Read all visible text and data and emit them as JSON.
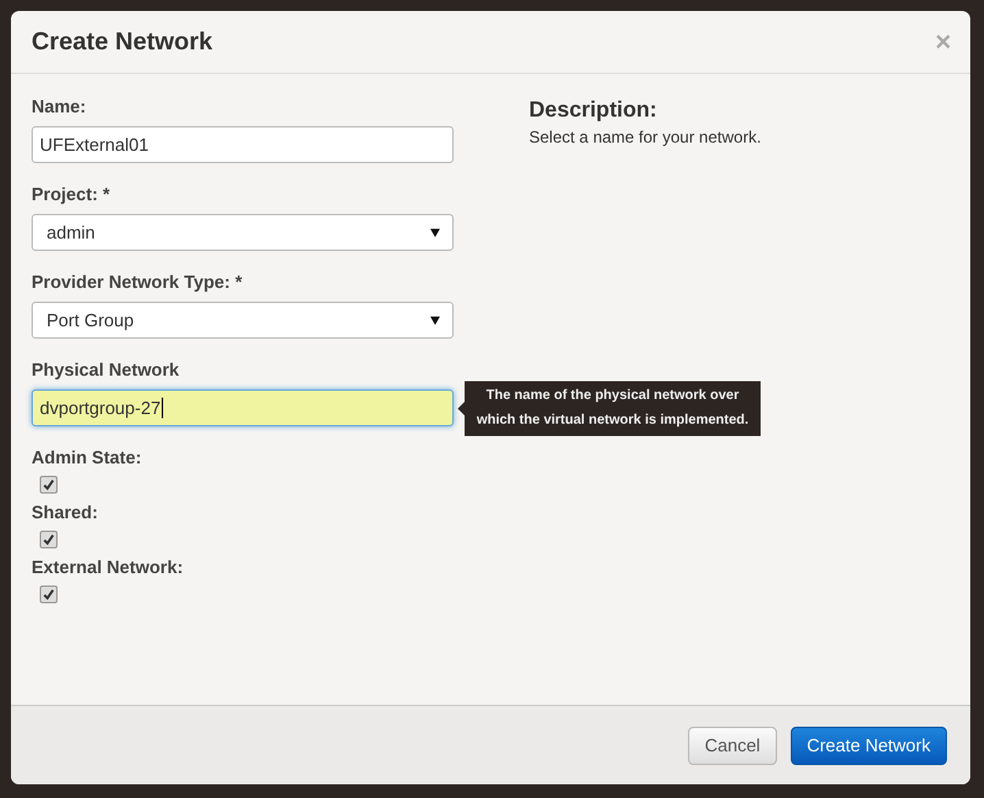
{
  "dialog": {
    "title": "Create Network",
    "close": "×"
  },
  "fields": [
    {
      "kind": "text",
      "label": "Name:",
      "value": "UFExternal01",
      "focused": false
    },
    {
      "kind": "select",
      "label": "Project: *",
      "value": "admin",
      "focused": false
    },
    {
      "kind": "select",
      "label": "Provider Network Type: *",
      "value": "Port Group",
      "focused": false
    },
    {
      "kind": "text",
      "label": "Physical Network",
      "value": "dvportgroup-27",
      "focused": true,
      "tooltip": "The name of the physical network over which the virtual network is implemented."
    },
    {
      "kind": "checkbox",
      "label": "Admin State:",
      "checked": true
    },
    {
      "kind": "checkbox",
      "label": "Shared:",
      "checked": true
    },
    {
      "kind": "checkbox",
      "label": "External Network:",
      "checked": true
    }
  ],
  "description": {
    "heading": "Description:",
    "text": "Select a name for your network."
  },
  "buttons": [
    {
      "kind": "secondary",
      "label": "Cancel"
    },
    {
      "kind": "primary",
      "label": "Create Network"
    }
  ]
}
